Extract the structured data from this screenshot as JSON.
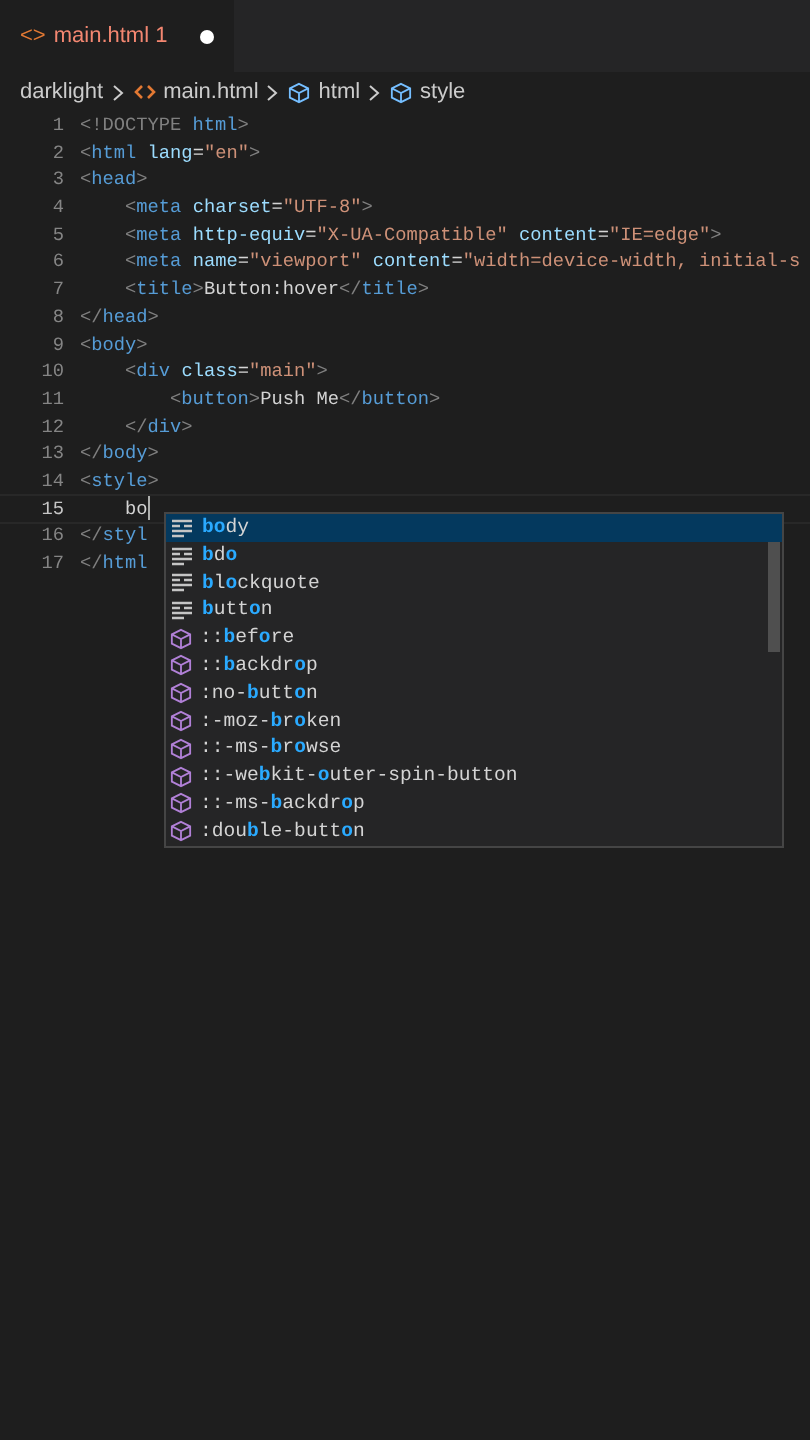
{
  "tab": {
    "icon": "<>",
    "label": "main.html",
    "problems": "1",
    "modified": true
  },
  "breadcrumb": [
    {
      "text": "darklight",
      "kind": "folder"
    },
    {
      "text": "main.html",
      "kind": "file"
    },
    {
      "text": "html",
      "kind": "element"
    },
    {
      "text": "style",
      "kind": "element"
    }
  ],
  "lines": [
    {
      "number": "1",
      "current": false,
      "text": "<!DOCTYPE html>"
    },
    {
      "number": "2",
      "current": false,
      "text": "<html lang=\"en\">"
    },
    {
      "number": "3",
      "current": false,
      "text": "<head>"
    },
    {
      "number": "4",
      "current": false,
      "text": "    <meta charset=\"UTF-8\">"
    },
    {
      "number": "5",
      "current": false,
      "text": "    <meta http-equiv=\"X-UA-Compatible\" content=\"IE=edge\">"
    },
    {
      "number": "6",
      "current": false,
      "text": "    <meta name=\"viewport\" content=\"width=device-width, initial-s"
    },
    {
      "number": "7",
      "current": false,
      "text": "    <title>Button:hover</title>"
    },
    {
      "number": "8",
      "current": false,
      "text": "</head>"
    },
    {
      "number": "9",
      "current": false,
      "text": "<body>"
    },
    {
      "number": "10",
      "current": false,
      "text": "    <div class=\"main\">"
    },
    {
      "number": "11",
      "current": false,
      "text": "        <button>Push Me</button>"
    },
    {
      "number": "12",
      "current": false,
      "text": "    </div>"
    },
    {
      "number": "13",
      "current": false,
      "text": "</body>"
    },
    {
      "number": "14",
      "current": false,
      "text": "<style>"
    },
    {
      "number": "15",
      "current": true,
      "text": "    bo"
    },
    {
      "number": "16",
      "current": false,
      "text": "</styl"
    },
    {
      "number": "17",
      "current": false,
      "text": "</html"
    }
  ],
  "suggestions": [
    {
      "kind": "element",
      "selected": true,
      "label": "body"
    },
    {
      "kind": "element",
      "selected": false,
      "label": "bdo"
    },
    {
      "kind": "element",
      "selected": false,
      "label": "blockquote"
    },
    {
      "kind": "element",
      "selected": false,
      "label": "button"
    },
    {
      "kind": "pseudo",
      "selected": false,
      "label": "::before"
    },
    {
      "kind": "pseudo",
      "selected": false,
      "label": "::backdrop"
    },
    {
      "kind": "pseudo",
      "selected": false,
      "label": ":no-button"
    },
    {
      "kind": "pseudo",
      "selected": false,
      "label": ":-moz-broken"
    },
    {
      "kind": "pseudo",
      "selected": false,
      "label": "::-ms-browse"
    },
    {
      "kind": "pseudo",
      "selected": false,
      "label": "::-webkit-outer-spin-button"
    },
    {
      "kind": "pseudo",
      "selected": false,
      "label": "::-ms-backdrop"
    },
    {
      "kind": "pseudo",
      "selected": false,
      "label": ":double-button"
    }
  ]
}
